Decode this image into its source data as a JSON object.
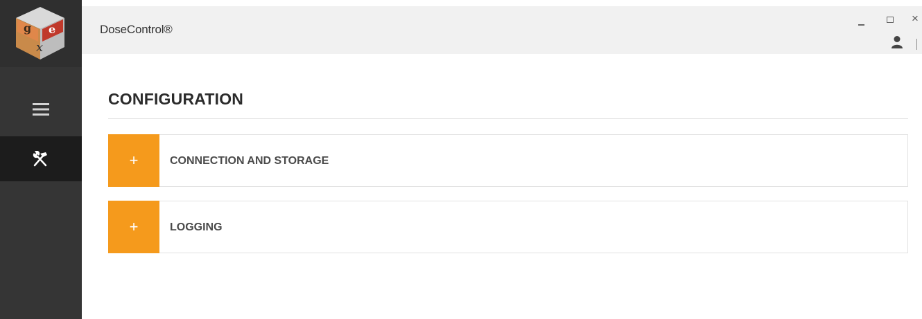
{
  "app": {
    "title": "DoseControl®"
  },
  "window_controls": {
    "minimize": "–",
    "maximize": "□",
    "close": "×"
  },
  "logo": {
    "letters": [
      "g",
      "e",
      "x"
    ]
  },
  "sidebar": {
    "items": [
      {
        "name": "menu",
        "icon": "hamburger-icon"
      },
      {
        "name": "configuration",
        "icon": "tools-icon",
        "active": true
      }
    ]
  },
  "page": {
    "title": "CONFIGURATION",
    "sections": [
      {
        "label": "CONNECTION AND STORAGE",
        "expander": "+"
      },
      {
        "label": "LOGGING",
        "expander": "+"
      }
    ]
  },
  "colors": {
    "accent": "#f59a1c",
    "sidebar": "#353535",
    "sidebar_active": "#1c1c1c",
    "topbar": "#f1f1f1"
  }
}
